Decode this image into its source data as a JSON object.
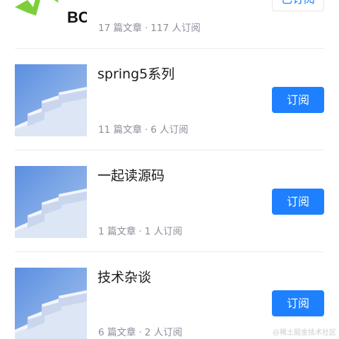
{
  "items": [
    {
      "title": "",
      "logo_text": "BC",
      "articles": "17 篇文章",
      "subscribers": "117 人订阅",
      "button": "已订阅",
      "subscribed": true
    },
    {
      "title": "spring5系列",
      "articles": "11 篇文章",
      "subscribers": "6 人订阅",
      "button": "订阅",
      "subscribed": false
    },
    {
      "title": "一起读源码",
      "articles": "1 篇文章",
      "subscribers": "1 人订阅",
      "button": "订阅",
      "subscribed": false
    },
    {
      "title": "技术杂谈",
      "articles": "6 篇文章",
      "subscribers": "2 人订阅",
      "button": "订阅",
      "subscribed": false
    }
  ],
  "separator": "·",
  "watermark": "@稀土掘金技术社区",
  "colors": {
    "accent": "#1e80ff",
    "thumb_sky": "#6d9de0",
    "logo_green": "#7ccf3a"
  },
  "icons": {
    "thumb": "stairs-illustration"
  }
}
